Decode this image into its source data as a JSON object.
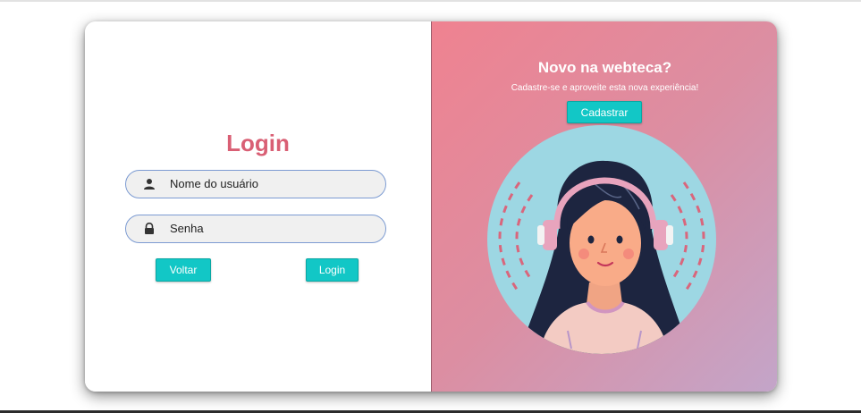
{
  "login": {
    "title": "Login",
    "username_placeholder": "Nome do usuário",
    "password_placeholder": "Senha",
    "back_label": "Voltar",
    "login_label": "Login",
    "icons": {
      "username": "user-icon",
      "password": "lock-icon"
    }
  },
  "promo": {
    "heading": "Novo na webteca?",
    "subtitle": "Cadastre-se e aproveite esta nova experiência!",
    "register_label": "Cadastrar",
    "illustration": "girl-with-headphones-illustration"
  },
  "colors": {
    "title": "#d95f74",
    "button": "#12c7c6",
    "field_border": "#7c9bd2",
    "gradient_start": "#ef8290",
    "gradient_end": "#c3a5c9",
    "illustration_circle": "#9dd7e3"
  }
}
